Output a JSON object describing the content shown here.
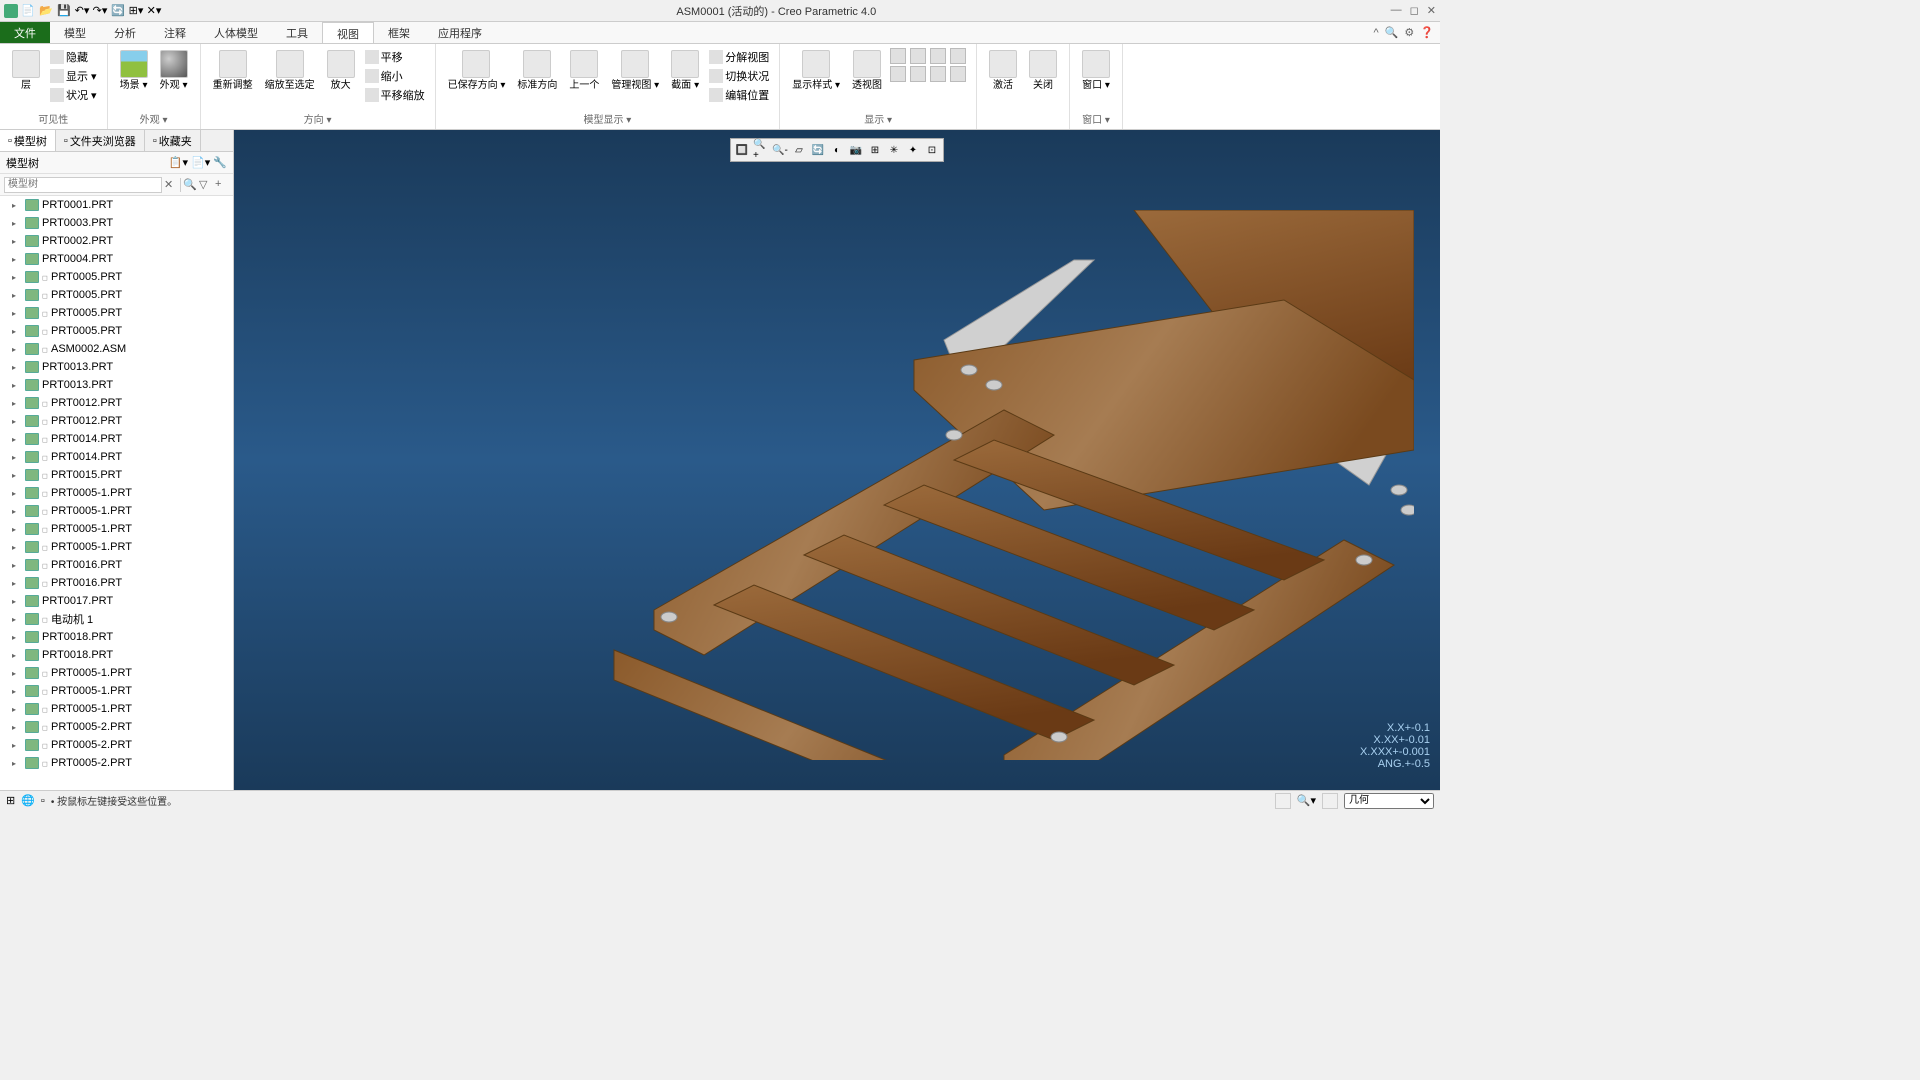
{
  "title": "ASM0001 (活动的) - Creo Parametric 4.0",
  "menu": {
    "file": "文件",
    "tabs": [
      "模型",
      "分析",
      "注释",
      "人体模型",
      "工具",
      "视图",
      "框架",
      "应用程序"
    ],
    "active": 5
  },
  "ribbon": {
    "groups": [
      {
        "label": "可见性",
        "items": [
          {
            "t": "big",
            "txt": "层"
          },
          {
            "t": "col",
            "items": [
              "隐藏",
              "显示 ▾",
              "状况 ▾"
            ]
          }
        ]
      },
      {
        "label": "外观 ▾",
        "items": [
          {
            "t": "big",
            "txt": "场景 ▾",
            "cls": "ico-scene"
          },
          {
            "t": "big",
            "txt": "外观 ▾",
            "cls": "ico-sphere"
          }
        ]
      },
      {
        "label": "方向 ▾",
        "items": [
          {
            "t": "big",
            "txt": "重新调整"
          },
          {
            "t": "big",
            "txt": "缩放至选定"
          },
          {
            "t": "big",
            "txt": "放大"
          },
          {
            "t": "col",
            "items": [
              "平移",
              "缩小",
              "平移缩放"
            ]
          }
        ]
      },
      {
        "label": "模型显示 ▾",
        "items": [
          {
            "t": "big",
            "txt": "已保存方向 ▾"
          },
          {
            "t": "big",
            "txt": "标准方向"
          },
          {
            "t": "big",
            "txt": "上一个"
          },
          {
            "t": "big",
            "txt": "管理视图 ▾"
          },
          {
            "t": "big",
            "txt": "截面 ▾"
          },
          {
            "t": "col",
            "items": [
              "分解视图",
              "切换状况",
              "编辑位置"
            ]
          }
        ]
      },
      {
        "label": "显示 ▾",
        "items": [
          {
            "t": "big",
            "txt": "显示样式 ▾"
          },
          {
            "t": "big",
            "txt": "透视图"
          },
          {
            "t": "grid"
          }
        ]
      },
      {
        "label": "",
        "items": [
          {
            "t": "big",
            "txt": "激活"
          },
          {
            "t": "big",
            "txt": "关闭"
          }
        ]
      },
      {
        "label": "窗口 ▾",
        "items": [
          {
            "t": "big",
            "txt": "窗口 ▾"
          }
        ]
      }
    ]
  },
  "sidebar": {
    "tabs": [
      {
        "label": "模型树",
        "icon": "tree"
      },
      {
        "label": "文件夹浏览器",
        "icon": "folder"
      },
      {
        "label": "收藏夹",
        "icon": "star"
      }
    ],
    "header": "模型树",
    "items": [
      {
        "n": "PRT0001.PRT"
      },
      {
        "n": "PRT0003.PRT"
      },
      {
        "n": "PRT0002.PRT"
      },
      {
        "n": "PRT0004.PRT"
      },
      {
        "n": "PRT0005.PRT",
        "s": true
      },
      {
        "n": "PRT0005.PRT",
        "s": true
      },
      {
        "n": "PRT0005.PRT",
        "s": true
      },
      {
        "n": "PRT0005.PRT",
        "s": true
      },
      {
        "n": "ASM0002.ASM",
        "s": true
      },
      {
        "n": "PRT0013.PRT"
      },
      {
        "n": "PRT0013.PRT"
      },
      {
        "n": "PRT0012.PRT",
        "s": true
      },
      {
        "n": "PRT0012.PRT",
        "s": true
      },
      {
        "n": "PRT0014.PRT",
        "s": true
      },
      {
        "n": "PRT0014.PRT",
        "s": true
      },
      {
        "n": "PRT0015.PRT",
        "s": true
      },
      {
        "n": "PRT0005-1.PRT",
        "s": true
      },
      {
        "n": "PRT0005-1.PRT",
        "s": true
      },
      {
        "n": "PRT0005-1.PRT",
        "s": true
      },
      {
        "n": "PRT0005-1.PRT",
        "s": true
      },
      {
        "n": "PRT0016.PRT",
        "s": true
      },
      {
        "n": "PRT0016.PRT",
        "s": true
      },
      {
        "n": "PRT0017.PRT"
      },
      {
        "n": "电动机 1",
        "s": true
      },
      {
        "n": "PRT0018.PRT"
      },
      {
        "n": "PRT0018.PRT"
      },
      {
        "n": "PRT0005-1.PRT",
        "s": true
      },
      {
        "n": "PRT0005-1.PRT",
        "s": true
      },
      {
        "n": "PRT0005-1.PRT",
        "s": true
      },
      {
        "n": "PRT0005-2.PRT",
        "s": true
      },
      {
        "n": "PRT0005-2.PRT",
        "s": true
      },
      {
        "n": "PRT0005-2.PRT",
        "s": true
      }
    ]
  },
  "coords": [
    "X.X+-0.1",
    "X.XX+-0.01",
    "X.XXX+-0.001",
    "ANG.+-0.5"
  ],
  "status": {
    "msg": "• 按鼠标左键接受这些位置。",
    "filter": "几何"
  }
}
